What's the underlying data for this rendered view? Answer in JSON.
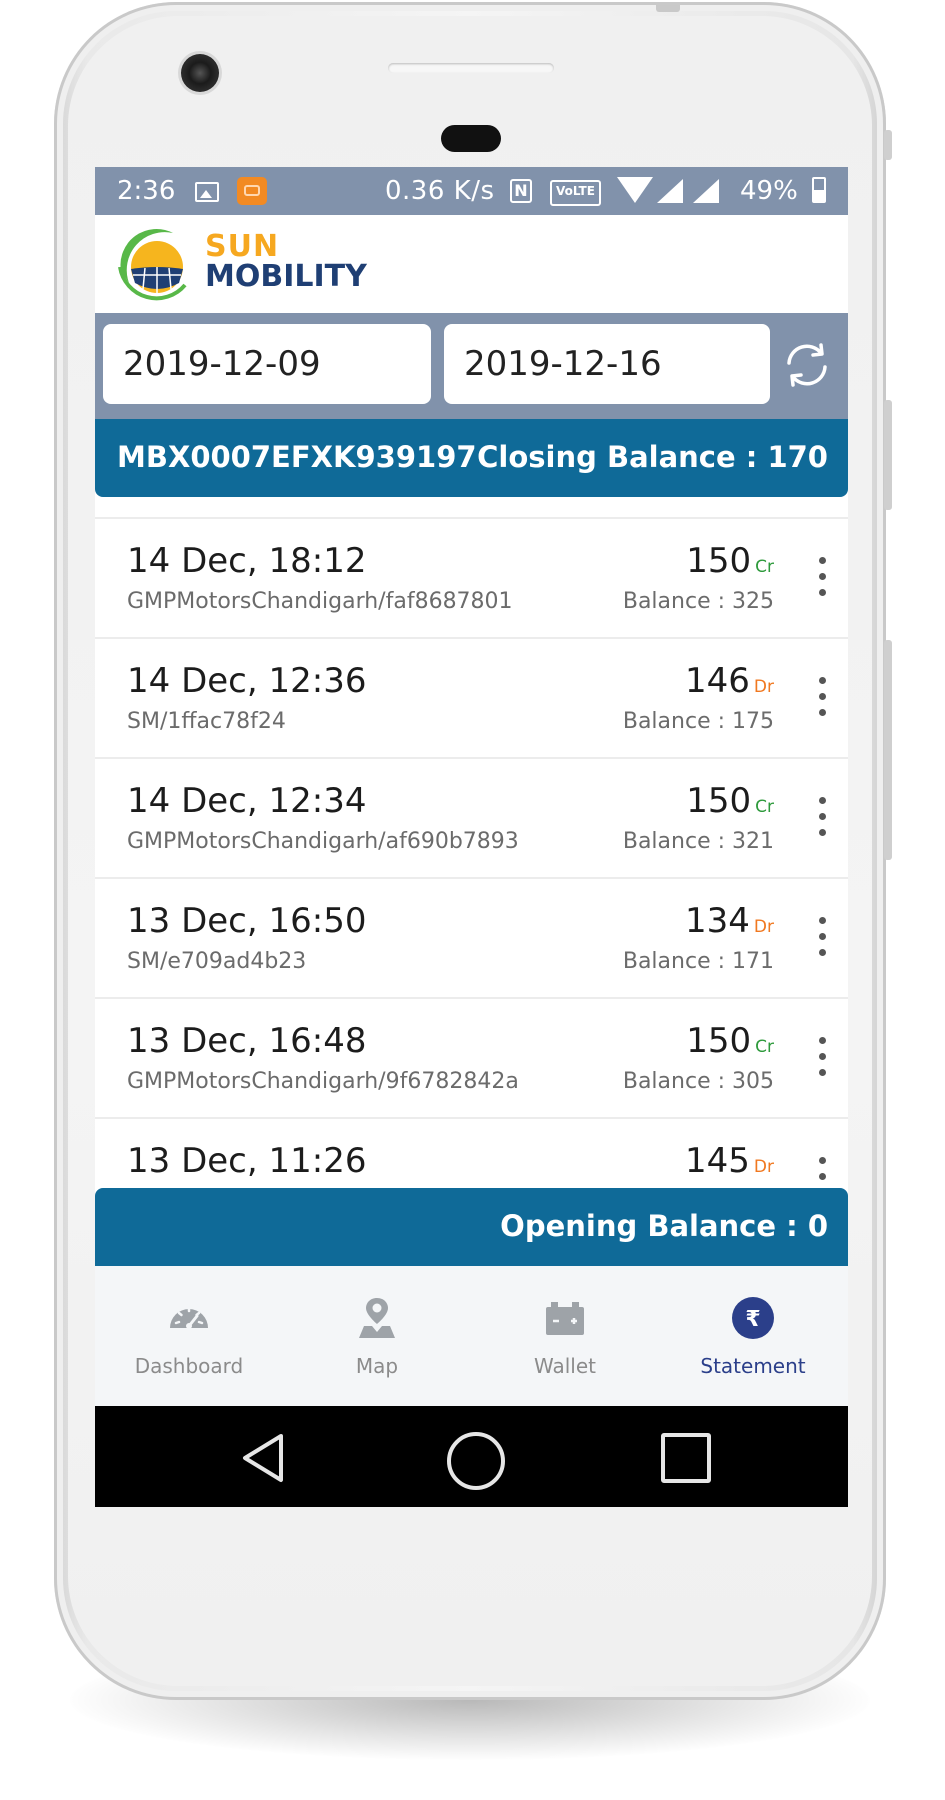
{
  "status_bar": {
    "time": "2:36",
    "network_speed": "0.36 K/s",
    "nfc_label": "N",
    "volte_label": "VoLTE",
    "battery": "49%"
  },
  "app": {
    "logo_line1": "SUN",
    "logo_line2": "MOBILITY",
    "brand_color_primary": "#0f6a98",
    "brand_color_header": "#8192ab"
  },
  "filters": {
    "from_date": "2019-12-09",
    "to_date": "2019-12-16"
  },
  "account": {
    "id": "MBX0007EFXK939197",
    "closing_balance_text": "Closing Balance : 170"
  },
  "transactions": [
    {
      "datetime": "14 Dec, 18:12",
      "reference": "GMPMotorsChandigarh/faf8687801",
      "amount": "150",
      "type": "Cr",
      "balance": "Balance : 325"
    },
    {
      "datetime": "14 Dec, 12:36",
      "reference": "SM/1ffac78f24",
      "amount": "146",
      "type": "Dr",
      "balance": "Balance : 175"
    },
    {
      "datetime": "14 Dec, 12:34",
      "reference": "GMPMotorsChandigarh/af690b7893",
      "amount": "150",
      "type": "Cr",
      "balance": "Balance : 321"
    },
    {
      "datetime": "13 Dec, 16:50",
      "reference": "SM/e709ad4b23",
      "amount": "134",
      "type": "Dr",
      "balance": "Balance : 171"
    },
    {
      "datetime": "13 Dec, 16:48",
      "reference": "GMPMotorsChandigarh/9f6782842a",
      "amount": "150",
      "type": "Cr",
      "balance": "Balance : 305"
    },
    {
      "datetime": "13 Dec, 11:26",
      "reference": "",
      "amount": "145",
      "type": "Dr",
      "balance": ""
    }
  ],
  "opening_balance_text": "Opening Balance : 0",
  "bottom_nav": [
    {
      "label": "Dashboard",
      "icon": "speedometer-icon",
      "active": false
    },
    {
      "label": "Map",
      "icon": "map-pin-icon",
      "active": false
    },
    {
      "label": "Wallet",
      "icon": "battery-wallet-icon",
      "active": false
    },
    {
      "label": "Statement",
      "icon": "rupee-icon",
      "active": true
    }
  ]
}
